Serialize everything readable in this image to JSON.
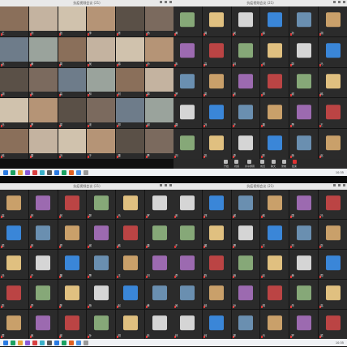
{
  "windows": [
    {
      "id": "w1",
      "title": "抗疫视频会议 (21)",
      "cols": 6,
      "rows": 5,
      "tile_tone": "video"
    },
    {
      "id": "w2",
      "title": "抗疫视频会议 (21)",
      "cols": 6,
      "rows": 5,
      "tile_tone": "avatar"
    },
    {
      "id": "w3",
      "title": "抗疫视频会议 (21)",
      "cols": 6,
      "rows": 5,
      "tile_tone": "mixed"
    },
    {
      "id": "w4",
      "title": "抗疫视频会议 (21)",
      "cols": 6,
      "rows": 5,
      "tile_tone": "mixed"
    }
  ],
  "participants": [
    "王",
    "刘",
    "张",
    "李",
    "陈",
    "杨",
    "赵",
    "黄",
    "周",
    "吴",
    "徐",
    "孙",
    "胡",
    "朱",
    "高",
    "林",
    "何",
    "郭",
    "马",
    "罗",
    "梁",
    "宋",
    "郑",
    "谢",
    "韩",
    "唐",
    "冯",
    "于",
    "董",
    "萧"
  ],
  "toolbar": [
    "开始",
    "视频",
    "共享屏幕",
    "成员",
    "聊天",
    "录制",
    "结束"
  ],
  "taskbar": {
    "time": "10:35"
  },
  "colors": {
    "tile": "#2b2b2b",
    "avatar_blue": "#3a86d8",
    "taskbar": "#f0f2f5",
    "toolbar": "#2a2a2a"
  }
}
